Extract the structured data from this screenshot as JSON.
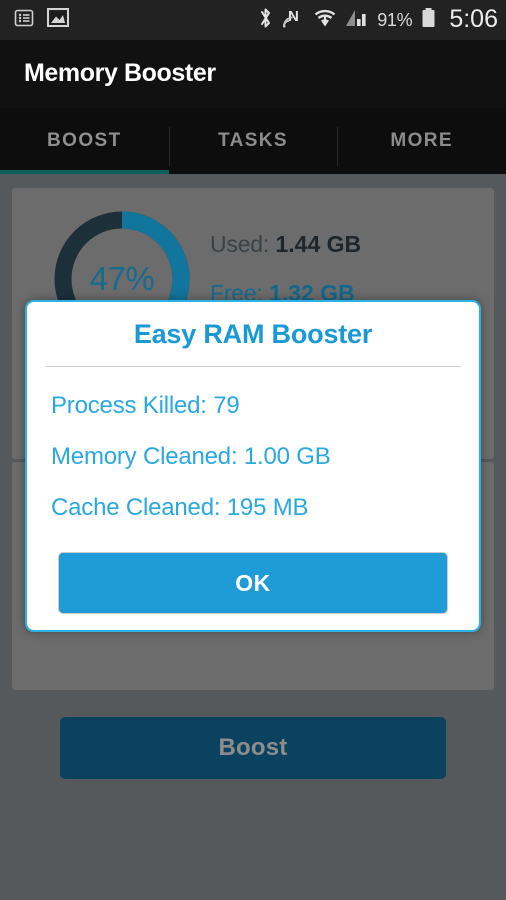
{
  "status_bar": {
    "icons_left": [
      "notification-list-icon",
      "image-icon"
    ],
    "icons_right": [
      "bluetooth-icon",
      "nfc-icon",
      "wifi-icon",
      "signal-icon"
    ],
    "battery_percent": "91%",
    "battery_icon": "battery-icon",
    "clock": "5:06"
  },
  "app": {
    "title": "Memory Booster"
  },
  "tabs": [
    {
      "label": "BOOST",
      "active": true
    },
    {
      "label": "TASKS",
      "active": false
    },
    {
      "label": "MORE",
      "active": false
    }
  ],
  "memory_card": {
    "gauge": {
      "percent_label": "47%",
      "percent_value": 47,
      "track_color": "#1d2f39",
      "progress_color": "#12759e"
    },
    "used_label": "Used:",
    "used_value": "1.44 GB",
    "free_label": "Free:",
    "free_value": "1.32 GB"
  },
  "boost_button": {
    "label": "Boost",
    "color": "#0b4260",
    "text_color": "#8d8d8d"
  },
  "dialog": {
    "title": "Easy RAM Booster",
    "title_color": "#1a9ad4",
    "border_color": "#2cb3e6",
    "lines": [
      "Process Killed: 79",
      "Memory Cleaned: 1.00 GB",
      "Cache Cleaned: 195 MB"
    ],
    "ok_label": "OK",
    "ok_color": "#1f9bd7"
  }
}
